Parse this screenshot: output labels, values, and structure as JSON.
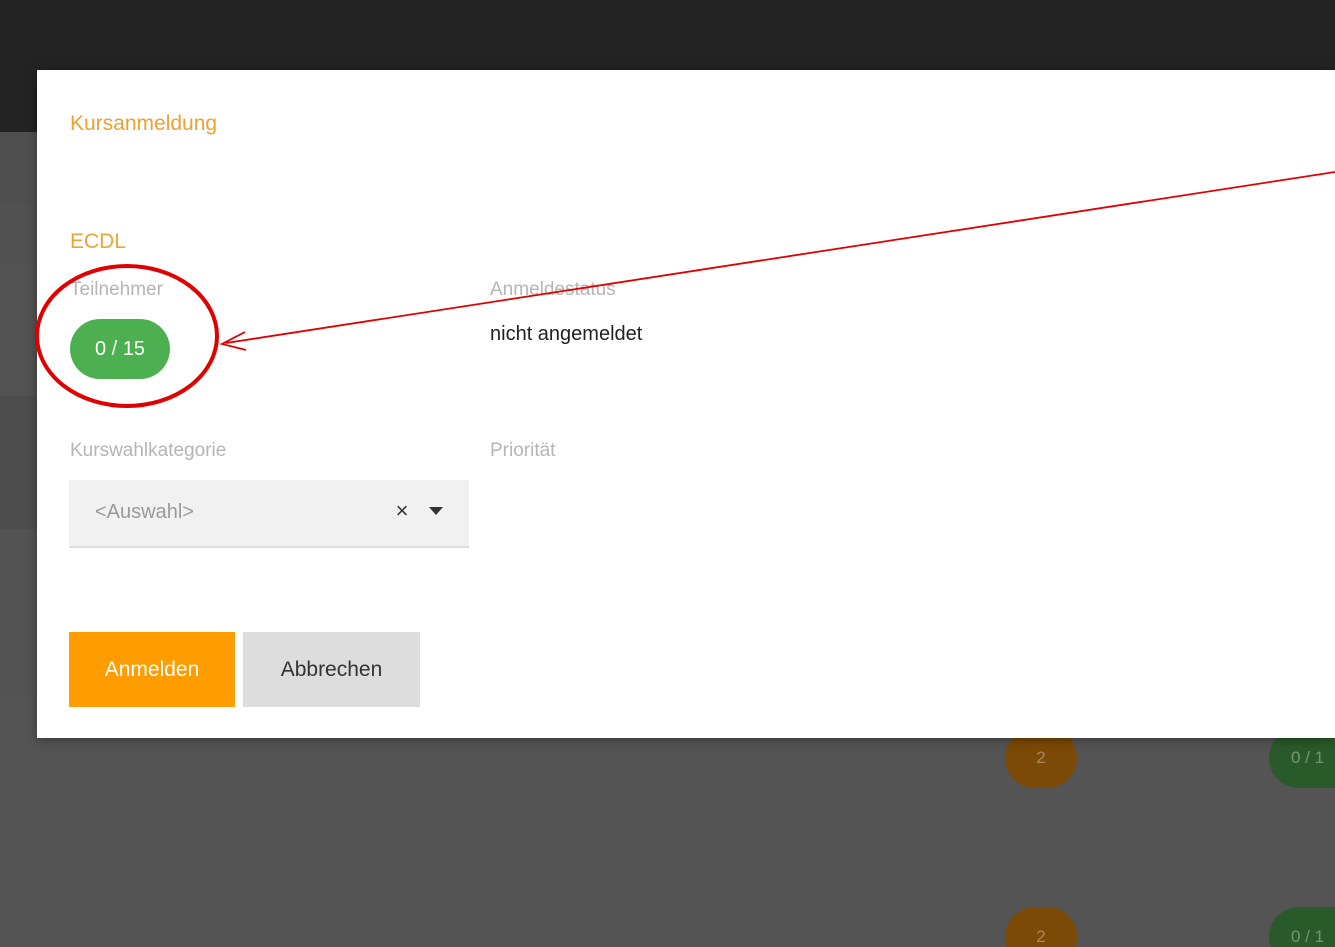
{
  "dialog": {
    "title": "Kursanmeldung",
    "course_name": "ECDL",
    "participants_label": "Teilnehmer",
    "participants_value": "0 / 15",
    "status_label": "Anmeldestatus",
    "status_value": "nicht angemeldet",
    "category_label": "Kurswahlkategorie",
    "category_select": {
      "value": "<Auswahl>",
      "clear_icon": "×",
      "arrow_icon": "chevron-down-icon"
    },
    "priority_label": "Priorität",
    "submit_label": "Anmelden",
    "cancel_label": "Abbrechen"
  },
  "background": {
    "rows": [
      {
        "priority": "2",
        "participants": "0 / 1"
      },
      {
        "priority": "2",
        "participants": "0 / 1"
      }
    ]
  },
  "colors": {
    "accent": "#ff9c00",
    "title": "#f0a030",
    "badge_green": "#4caf50",
    "annotation_red": "#e00000"
  }
}
